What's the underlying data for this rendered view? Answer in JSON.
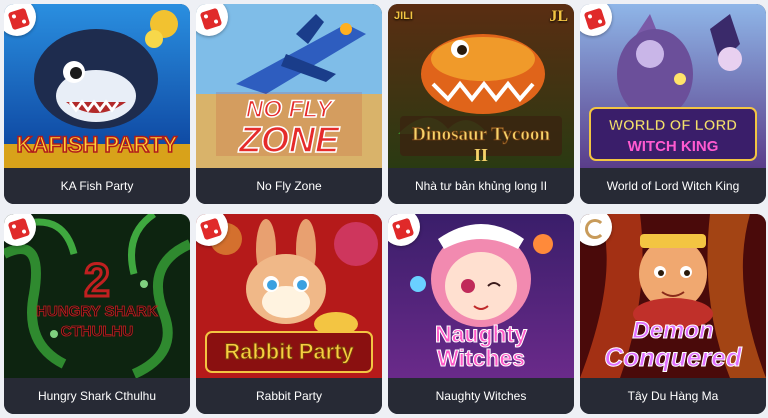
{
  "games": [
    {
      "title": "KA Fish Party",
      "logo": "KAFISH PARTY",
      "provider": "dice-icon"
    },
    {
      "title": "No Fly Zone",
      "logo_line1": "NO FLY",
      "logo_line2": "ZONE",
      "provider": "dice-icon"
    },
    {
      "title": "Nhà tư bản khủng long II",
      "logo_line1": "Dinosaur Tycoon",
      "logo_line2": "II",
      "badge_left": "JILI",
      "badge_right": "JL"
    },
    {
      "title": "World of Lord Witch King",
      "logo_line1": "WORLD OF LORD",
      "logo_line2": "WITCH KING",
      "provider": "dice-icon"
    },
    {
      "title": "Hungry Shark Cthulhu",
      "logo_line1": "HUNGRY SHARK",
      "logo_line2": "CTHULHU",
      "logo_number": "2",
      "provider": "dice-icon"
    },
    {
      "title": "Rabbit Party",
      "logo": "Rabbit Party",
      "provider": "dice-icon"
    },
    {
      "title": "Naughty Witches",
      "logo_line1": "Naughty",
      "logo_line2": "Witches",
      "provider": "dice-icon"
    },
    {
      "title": "Tây Du Hàng Ma",
      "logo_line1": "Demon",
      "logo_line2": "Conquered",
      "provider": "swirl-icon"
    }
  ]
}
